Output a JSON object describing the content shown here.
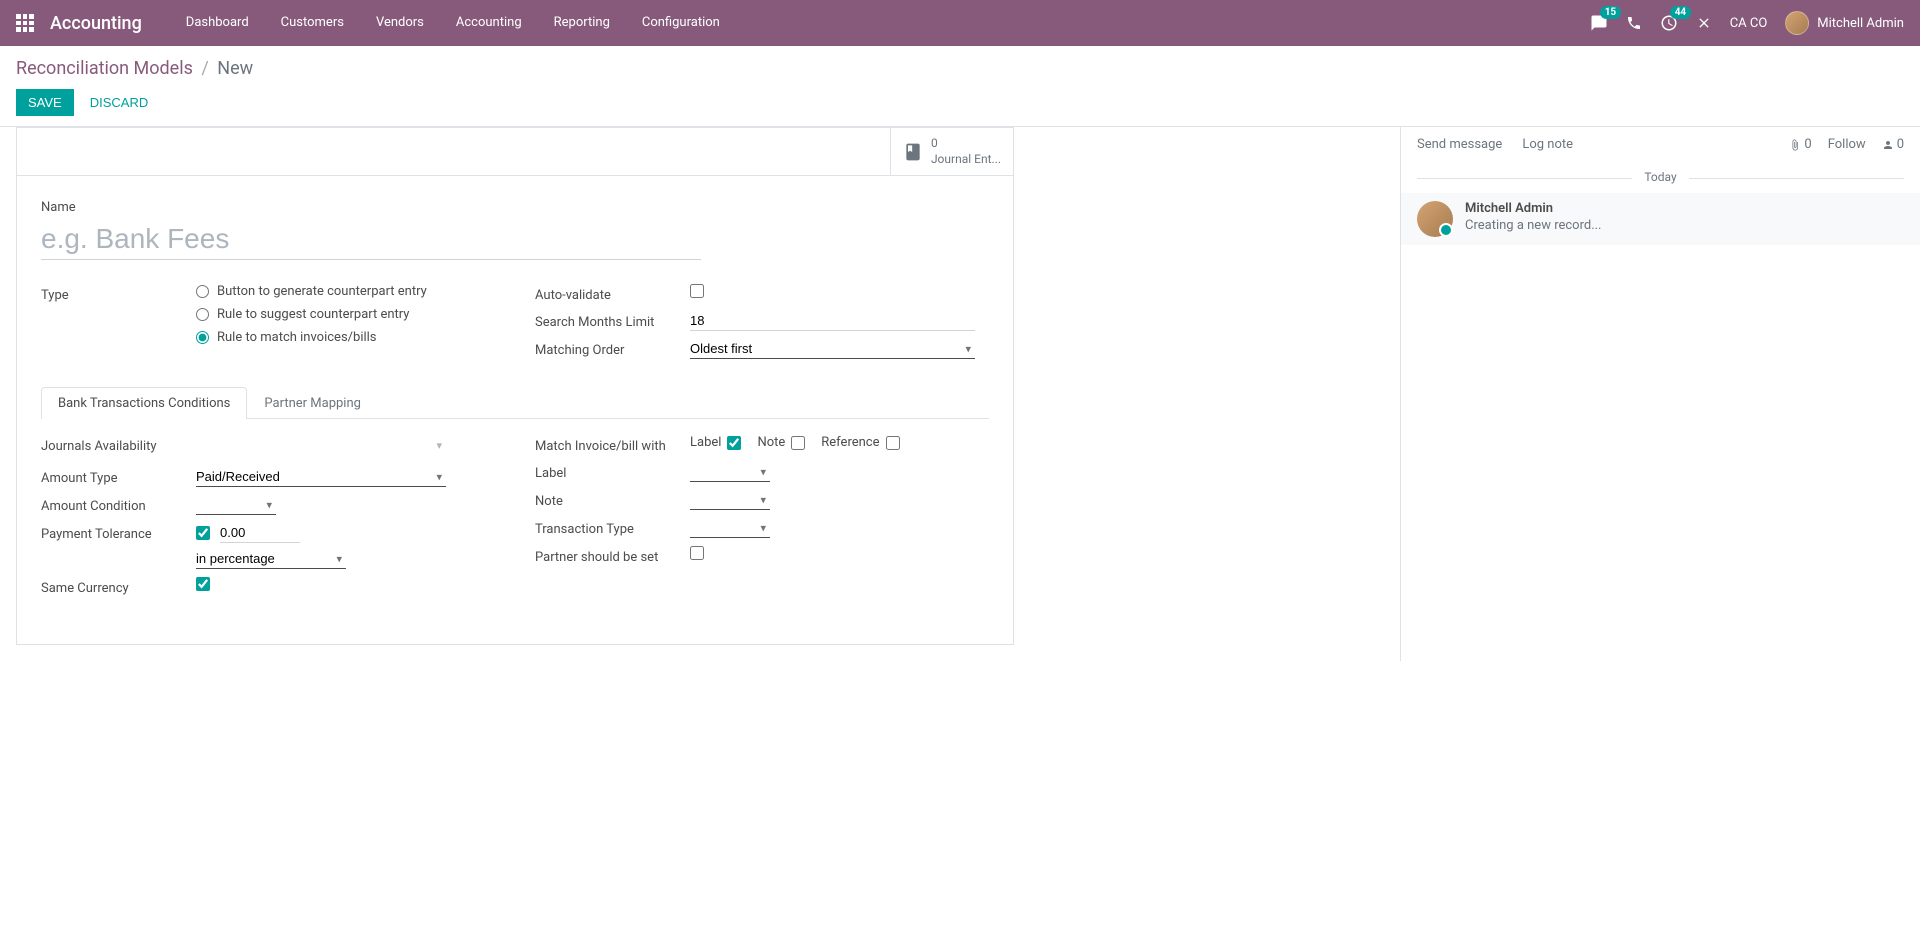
{
  "navbar": {
    "brand": "Accounting",
    "menu": [
      "Dashboard",
      "Customers",
      "Vendors",
      "Accounting",
      "Reporting",
      "Configuration"
    ],
    "messages_count": "15",
    "activities_count": "44",
    "company": "CA CO",
    "user": "Mitchell Admin"
  },
  "breadcrumb": {
    "parent": "Reconciliation Models",
    "current": "New"
  },
  "buttons": {
    "save": "Save",
    "discard": "Discard"
  },
  "stat_button": {
    "count": "0",
    "label": "Journal Ent..."
  },
  "form": {
    "name_label": "Name",
    "name_placeholder": "e.g. Bank Fees",
    "type_label": "Type",
    "type_options": {
      "button": "Button to generate counterpart entry",
      "rule_suggest": "Rule to suggest counterpart entry",
      "rule_match": "Rule to match invoices/bills"
    },
    "auto_validate_label": "Auto-validate",
    "search_months_label": "Search Months Limit",
    "search_months_value": "18",
    "matching_order_label": "Matching Order",
    "matching_order_value": "Oldest first"
  },
  "tabs": {
    "bank_conditions": "Bank Transactions Conditions",
    "partner_mapping": "Partner Mapping"
  },
  "tab_content": {
    "journals_label": "Journals Availability",
    "amount_type_label": "Amount Type",
    "amount_type_value": "Paid/Received",
    "amount_condition_label": "Amount Condition",
    "payment_tolerance_label": "Payment Tolerance",
    "payment_tolerance_value": "0.00",
    "payment_tolerance_unit": "in percentage",
    "same_currency_label": "Same Currency",
    "match_invoice_label": "Match Invoice/bill with",
    "match_label": "Label",
    "match_note": "Note",
    "match_reference": "Reference",
    "label_label": "Label",
    "note_label": "Note",
    "transaction_type_label": "Transaction Type",
    "partner_set_label": "Partner should be set"
  },
  "chatter": {
    "send_message": "Send message",
    "log_note": "Log note",
    "follow": "Follow",
    "attachment_count": "0",
    "follower_count": "0",
    "date": "Today",
    "message_author": "Mitchell Admin",
    "message_text": "Creating a new record..."
  }
}
